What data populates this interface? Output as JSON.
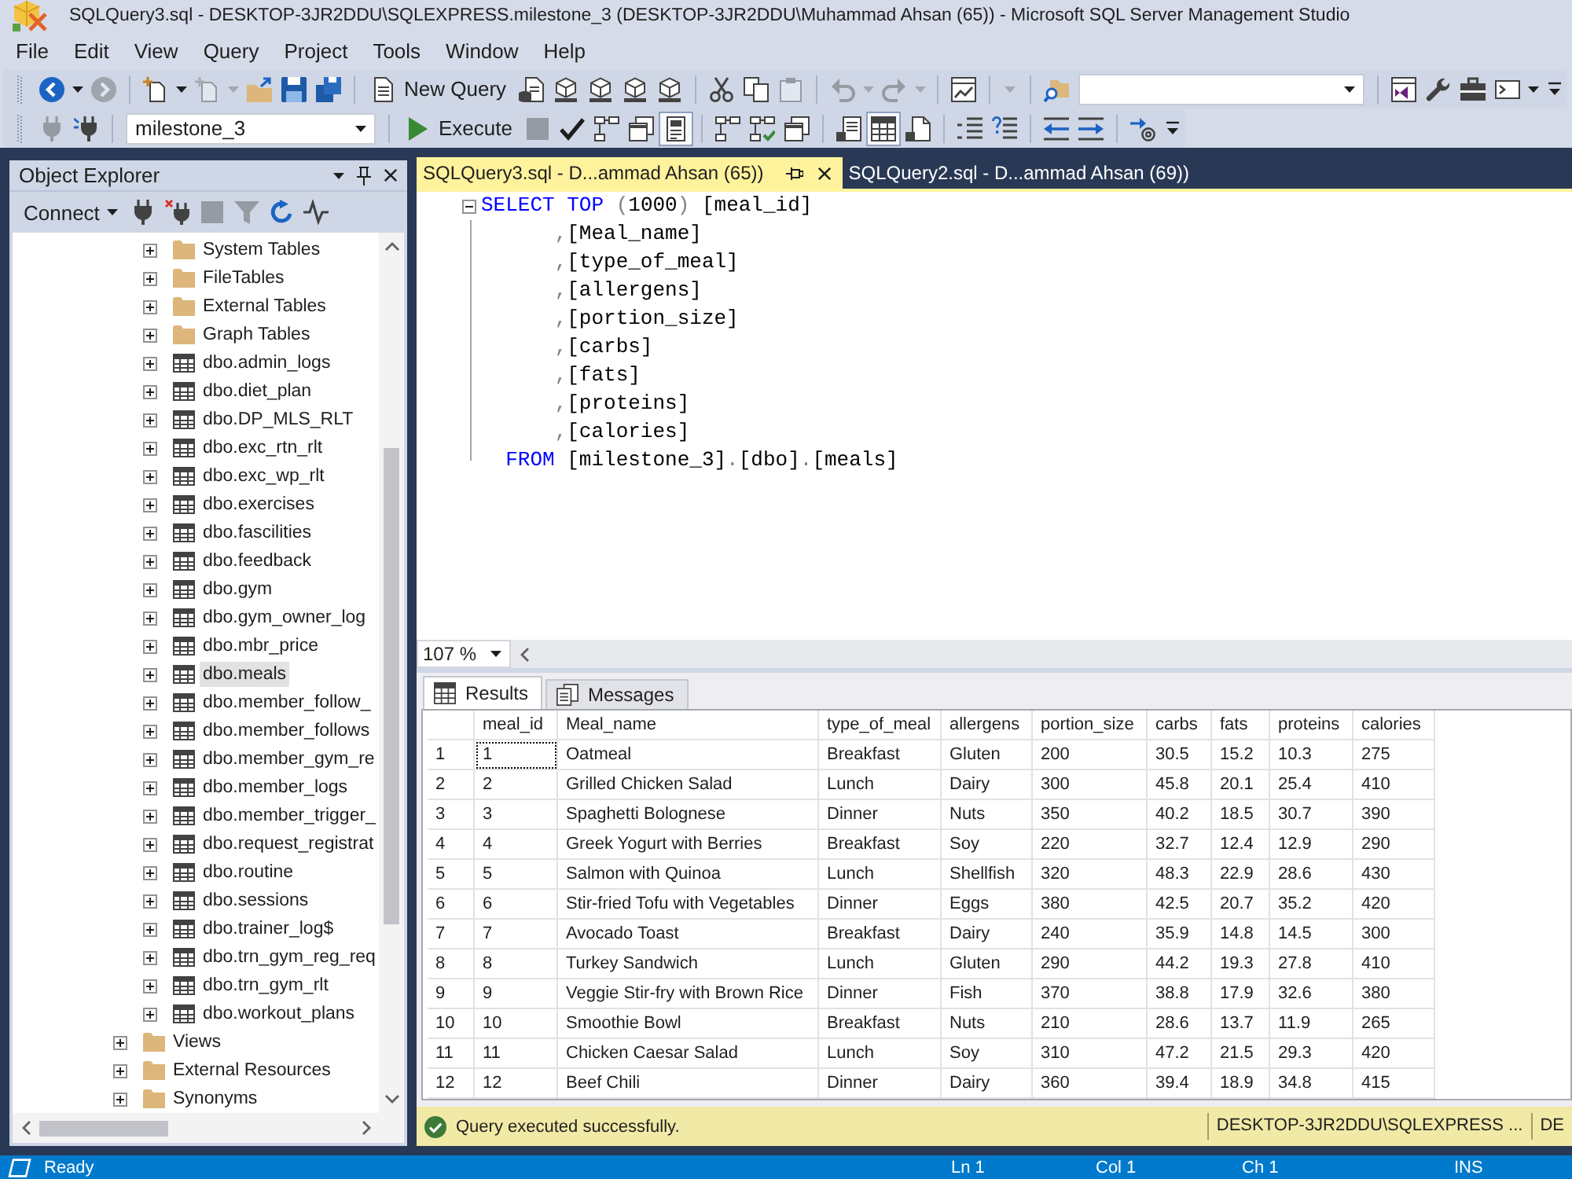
{
  "window": {
    "title": "SQLQuery3.sql - DESKTOP-3JR2DDU\\SQLEXPRESS.milestone_3 (DESKTOP-3JR2DDU\\Muhammad Ahsan (65)) - Microsoft SQL Server Management Studio"
  },
  "menu": [
    "File",
    "Edit",
    "View",
    "Query",
    "Project",
    "Tools",
    "Window",
    "Help"
  ],
  "toolbar_1": {
    "groups": [
      [
        {
          "kind": "split",
          "disabled": false
        },
        {
          "kind": "button",
          "disabled": true
        }
      ],
      [
        {
          "kind": "split",
          "disabled": false
        },
        {
          "kind": "split",
          "disabled": true
        },
        {
          "kind": "button",
          "disabled": false
        },
        {
          "kind": "button",
          "disabled": false
        },
        {
          "kind": "button",
          "disabled": false
        }
      ],
      [
        {
          "kind": "labeled",
          "label": "New Query",
          "disabled": false
        },
        {
          "kind": "button",
          "disabled": false
        },
        {
          "kind": "button",
          "disabled": false
        },
        {
          "kind": "button",
          "disabled": false
        },
        {
          "kind": "button",
          "disabled": false
        },
        {
          "kind": "button",
          "disabled": false
        }
      ],
      [
        {
          "kind": "button",
          "disabled": false
        },
        {
          "kind": "button",
          "disabled": false
        },
        {
          "kind": "button",
          "disabled": true
        }
      ],
      [
        {
          "kind": "split",
          "disabled": true
        },
        {
          "kind": "split",
          "disabled": true
        }
      ],
      [
        {
          "kind": "button",
          "disabled": false
        }
      ],
      [
        {
          "kind": "caret",
          "disabled": true
        }
      ],
      [
        {
          "kind": "button",
          "disabled": false
        },
        {
          "kind": "combo"
        }
      ],
      [
        {
          "kind": "button",
          "disabled": false
        },
        {
          "kind": "button",
          "disabled": false
        },
        {
          "kind": "button",
          "disabled": false
        },
        {
          "kind": "split",
          "disabled": false
        }
      ]
    ]
  },
  "toolbar_2": {
    "groups": [
      [
        {
          "kind": "button",
          "disabled": true
        },
        {
          "kind": "button",
          "disabled": false
        }
      ],
      [
        {
          "kind": "combo",
          "value": "milestone_3"
        }
      ],
      [
        {
          "kind": "labeled",
          "label": "Execute",
          "disabled": false
        },
        {
          "kind": "button",
          "disabled": true
        },
        {
          "kind": "button",
          "disabled": false
        },
        {
          "kind": "button",
          "disabled": false
        },
        {
          "kind": "button",
          "disabled": false
        },
        {
          "kind": "button",
          "disabled": false,
          "pressed": true
        }
      ],
      [
        {
          "kind": "button",
          "disabled": false,
          "pressed": false
        },
        {
          "kind": "button",
          "disabled": false,
          "pressed": false
        },
        {
          "kind": "button",
          "disabled": false,
          "pressed": false
        }
      ],
      [
        {
          "kind": "button",
          "disabled": false,
          "pressed": false
        },
        {
          "kind": "button",
          "disabled": false,
          "pressed": true
        },
        {
          "kind": "button",
          "disabled": false,
          "pressed": false
        }
      ],
      [
        {
          "kind": "button",
          "disabled": false
        },
        {
          "kind": "button",
          "disabled": false
        }
      ],
      [
        {
          "kind": "button",
          "disabled": false
        },
        {
          "kind": "button",
          "disabled": false
        }
      ],
      [
        {
          "kind": "button",
          "disabled": false
        }
      ]
    ]
  },
  "object_explorer": {
    "title": "Object Explorer",
    "toolbar": [
      {
        "kind": "menu",
        "label": "Connect",
        "disabled": false
      },
      {
        "kind": "button",
        "disabled": false
      },
      {
        "kind": "button",
        "disabled": false
      },
      {
        "kind": "button",
        "disabled": true
      },
      {
        "kind": "button",
        "disabled": true
      },
      {
        "kind": "button",
        "disabled": false
      },
      {
        "kind": "button",
        "disabled": false
      }
    ],
    "tree": {
      "items": [
        {
          "children": [
            {
              "kind": "folder",
              "label": "System Tables",
              "expanded": false,
              "selected": false
            },
            {
              "kind": "folder",
              "label": "FileTables",
              "expanded": false,
              "selected": false
            },
            {
              "kind": "folder",
              "label": "External Tables",
              "expanded": false,
              "selected": false
            },
            {
              "kind": "folder",
              "label": "Graph Tables",
              "expanded": false,
              "selected": false
            },
            {
              "kind": "table",
              "label": "dbo.admin_logs",
              "expanded": false,
              "selected": false
            },
            {
              "kind": "table",
              "label": "dbo.diet_plan",
              "expanded": false,
              "selected": false
            },
            {
              "kind": "table",
              "label": "dbo.DP_MLS_RLT",
              "expanded": false,
              "selected": false
            },
            {
              "kind": "table",
              "label": "dbo.exc_rtn_rlt",
              "expanded": false,
              "selected": false
            },
            {
              "kind": "table",
              "label": "dbo.exc_wp_rlt",
              "expanded": false,
              "selected": false
            },
            {
              "kind": "table",
              "label": "dbo.exercises",
              "expanded": false,
              "selected": false
            },
            {
              "kind": "table",
              "label": "dbo.fascilities",
              "expanded": false,
              "selected": false
            },
            {
              "kind": "table",
              "label": "dbo.feedback",
              "expanded": false,
              "selected": false
            },
            {
              "kind": "table",
              "label": "dbo.gym",
              "expanded": false,
              "selected": false
            },
            {
              "kind": "table",
              "label": "dbo.gym_owner_log",
              "expanded": false,
              "selected": false
            },
            {
              "kind": "table",
              "label": "dbo.mbr_price",
              "expanded": false,
              "selected": false
            },
            {
              "kind": "table",
              "label": "dbo.meals",
              "expanded": false,
              "selected": true
            },
            {
              "kind": "table",
              "label": "dbo.member_follow_",
              "expanded": false,
              "selected": false
            },
            {
              "kind": "table",
              "label": "dbo.member_follows",
              "expanded": false,
              "selected": false
            },
            {
              "kind": "table",
              "label": "dbo.member_gym_re",
              "expanded": false,
              "selected": false
            },
            {
              "kind": "table",
              "label": "dbo.member_logs",
              "expanded": false,
              "selected": false
            },
            {
              "kind": "table",
              "label": "dbo.member_trigger_",
              "expanded": false,
              "selected": false
            },
            {
              "kind": "table",
              "label": "dbo.request_registrat",
              "expanded": false,
              "selected": false
            },
            {
              "kind": "table",
              "label": "dbo.routine",
              "expanded": false,
              "selected": false
            },
            {
              "kind": "table",
              "label": "dbo.sessions",
              "expanded": false,
              "selected": false
            },
            {
              "kind": "table",
              "label": "dbo.trainer_log$",
              "expanded": false,
              "selected": false
            },
            {
              "kind": "table",
              "label": "dbo.trn_gym_reg_req",
              "expanded": false,
              "selected": false
            },
            {
              "kind": "table",
              "label": "dbo.trn_gym_rlt",
              "expanded": false,
              "selected": false
            },
            {
              "kind": "table",
              "label": "dbo.workout_plans",
              "expanded": false,
              "selected": false
            }
          ]
        },
        {
          "kind": "folder",
          "label": "Views",
          "expanded": false,
          "selected": false
        },
        {
          "kind": "folder",
          "label": "External Resources",
          "expanded": false,
          "selected": false
        },
        {
          "kind": "folder",
          "label": "Synonyms",
          "expanded": false,
          "selected": false
        }
      ]
    }
  },
  "editor": {
    "tabs": [
      {
        "label": "SQLQuery3.sql - D...ammad Ahsan (65))",
        "selected": true
      },
      {
        "label": "SQLQuery2.sql - D...ammad Ahsan (69))",
        "selected": false
      }
    ],
    "region_expanded": true,
    "code": [
      {
        "tokens": [
          {
            "kind": "keyword",
            "text": "SELECT TOP "
          },
          {
            "kind": "operator",
            "text": "("
          },
          {
            "kind": "plain",
            "text": "1000"
          },
          {
            "kind": "operator",
            "text": ")"
          },
          {
            "kind": "plain",
            "text": " [meal_id]"
          }
        ]
      },
      {
        "tokens": [
          {
            "kind": "operator",
            "text": "      ,"
          },
          {
            "kind": "plain",
            "text": "[Meal_name]"
          }
        ]
      },
      {
        "tokens": [
          {
            "kind": "operator",
            "text": "      ,"
          },
          {
            "kind": "plain",
            "text": "[type_of_meal]"
          }
        ]
      },
      {
        "tokens": [
          {
            "kind": "operator",
            "text": "      ,"
          },
          {
            "kind": "plain",
            "text": "[allergens]"
          }
        ]
      },
      {
        "tokens": [
          {
            "kind": "operator",
            "text": "      ,"
          },
          {
            "kind": "plain",
            "text": "[portion_size]"
          }
        ]
      },
      {
        "tokens": [
          {
            "kind": "operator",
            "text": "      ,"
          },
          {
            "kind": "plain",
            "text": "[carbs]"
          }
        ]
      },
      {
        "tokens": [
          {
            "kind": "operator",
            "text": "      ,"
          },
          {
            "kind": "plain",
            "text": "[fats]"
          }
        ]
      },
      {
        "tokens": [
          {
            "kind": "operator",
            "text": "      ,"
          },
          {
            "kind": "plain",
            "text": "[proteins]"
          }
        ]
      },
      {
        "tokens": [
          {
            "kind": "operator",
            "text": "      ,"
          },
          {
            "kind": "plain",
            "text": "[calories]"
          }
        ]
      },
      {
        "tokens": [
          {
            "kind": "keyword",
            "text": "  FROM "
          },
          {
            "kind": "plain",
            "text": "[milestone_3]"
          },
          {
            "kind": "operator",
            "text": "."
          },
          {
            "kind": "plain",
            "text": "[dbo]"
          },
          {
            "kind": "operator",
            "text": "."
          },
          {
            "kind": "plain",
            "text": "[meals]"
          }
        ]
      }
    ],
    "zoom": "107 %"
  },
  "results": {
    "tabs": [
      {
        "label": "Results",
        "selected": true
      },
      {
        "label": "Messages",
        "selected": false
      }
    ],
    "grid": {
      "columns": [
        "meal_id",
        "Meal_name",
        "type_of_meal",
        "allergens",
        "portion_size",
        "carbs",
        "fats",
        "proteins",
        "calories"
      ],
      "rows": [
        {
          "number": "1",
          "cells": [
            {
              "text": "1",
              "focused": true
            },
            {
              "text": "Oatmeal",
              "focused": false
            },
            {
              "text": "Breakfast",
              "focused": false
            },
            {
              "text": "Gluten",
              "focused": false
            },
            {
              "text": "200",
              "focused": false
            },
            {
              "text": "30.5",
              "focused": false
            },
            {
              "text": "15.2",
              "focused": false
            },
            {
              "text": "10.3",
              "focused": false
            },
            {
              "text": "275",
              "focused": false
            }
          ]
        },
        {
          "number": "2",
          "cells": [
            {
              "text": "2",
              "focused": false
            },
            {
              "text": "Grilled Chicken Salad",
              "focused": false
            },
            {
              "text": "Lunch",
              "focused": false
            },
            {
              "text": "Dairy",
              "focused": false
            },
            {
              "text": "300",
              "focused": false
            },
            {
              "text": "45.8",
              "focused": false
            },
            {
              "text": "20.1",
              "focused": false
            },
            {
              "text": "25.4",
              "focused": false
            },
            {
              "text": "410",
              "focused": false
            }
          ]
        },
        {
          "number": "3",
          "cells": [
            {
              "text": "3",
              "focused": false
            },
            {
              "text": "Spaghetti Bolognese",
              "focused": false
            },
            {
              "text": "Dinner",
              "focused": false
            },
            {
              "text": "Nuts",
              "focused": false
            },
            {
              "text": "350",
              "focused": false
            },
            {
              "text": "40.2",
              "focused": false
            },
            {
              "text": "18.5",
              "focused": false
            },
            {
              "text": "30.7",
              "focused": false
            },
            {
              "text": "390",
              "focused": false
            }
          ]
        },
        {
          "number": "4",
          "cells": [
            {
              "text": "4",
              "focused": false
            },
            {
              "text": "Greek Yogurt with Berries",
              "focused": false
            },
            {
              "text": "Breakfast",
              "focused": false
            },
            {
              "text": "Soy",
              "focused": false
            },
            {
              "text": "220",
              "focused": false
            },
            {
              "text": "32.7",
              "focused": false
            },
            {
              "text": "12.4",
              "focused": false
            },
            {
              "text": "12.9",
              "focused": false
            },
            {
              "text": "290",
              "focused": false
            }
          ]
        },
        {
          "number": "5",
          "cells": [
            {
              "text": "5",
              "focused": false
            },
            {
              "text": "Salmon with Quinoa",
              "focused": false
            },
            {
              "text": "Lunch",
              "focused": false
            },
            {
              "text": "Shellfish",
              "focused": false
            },
            {
              "text": "320",
              "focused": false
            },
            {
              "text": "48.3",
              "focused": false
            },
            {
              "text": "22.9",
              "focused": false
            },
            {
              "text": "28.6",
              "focused": false
            },
            {
              "text": "430",
              "focused": false
            }
          ]
        },
        {
          "number": "6",
          "cells": [
            {
              "text": "6",
              "focused": false
            },
            {
              "text": "Stir-fried Tofu with Vegetables",
              "focused": false
            },
            {
              "text": "Dinner",
              "focused": false
            },
            {
              "text": "Eggs",
              "focused": false
            },
            {
              "text": "380",
              "focused": false
            },
            {
              "text": "42.5",
              "focused": false
            },
            {
              "text": "20.7",
              "focused": false
            },
            {
              "text": "35.2",
              "focused": false
            },
            {
              "text": "420",
              "focused": false
            }
          ]
        },
        {
          "number": "7",
          "cells": [
            {
              "text": "7",
              "focused": false
            },
            {
              "text": "Avocado Toast",
              "focused": false
            },
            {
              "text": "Breakfast",
              "focused": false
            },
            {
              "text": "Dairy",
              "focused": false
            },
            {
              "text": "240",
              "focused": false
            },
            {
              "text": "35.9",
              "focused": false
            },
            {
              "text": "14.8",
              "focused": false
            },
            {
              "text": "14.5",
              "focused": false
            },
            {
              "text": "300",
              "focused": false
            }
          ]
        },
        {
          "number": "8",
          "cells": [
            {
              "text": "8",
              "focused": false
            },
            {
              "text": "Turkey Sandwich",
              "focused": false
            },
            {
              "text": "Lunch",
              "focused": false
            },
            {
              "text": "Gluten",
              "focused": false
            },
            {
              "text": "290",
              "focused": false
            },
            {
              "text": "44.2",
              "focused": false
            },
            {
              "text": "19.3",
              "focused": false
            },
            {
              "text": "27.8",
              "focused": false
            },
            {
              "text": "410",
              "focused": false
            }
          ]
        },
        {
          "number": "9",
          "cells": [
            {
              "text": "9",
              "focused": false
            },
            {
              "text": "Veggie Stir-fry with Brown Rice",
              "focused": false
            },
            {
              "text": "Dinner",
              "focused": false
            },
            {
              "text": "Fish",
              "focused": false
            },
            {
              "text": "370",
              "focused": false
            },
            {
              "text": "38.8",
              "focused": false
            },
            {
              "text": "17.9",
              "focused": false
            },
            {
              "text": "32.6",
              "focused": false
            },
            {
              "text": "380",
              "focused": false
            }
          ]
        },
        {
          "number": "10",
          "cells": [
            {
              "text": "10",
              "focused": false
            },
            {
              "text": "Smoothie Bowl",
              "focused": false
            },
            {
              "text": "Breakfast",
              "focused": false
            },
            {
              "text": "Nuts",
              "focused": false
            },
            {
              "text": "210",
              "focused": false
            },
            {
              "text": "28.6",
              "focused": false
            },
            {
              "text": "13.7",
              "focused": false
            },
            {
              "text": "11.9",
              "focused": false
            },
            {
              "text": "265",
              "focused": false
            }
          ]
        },
        {
          "number": "11",
          "cells": [
            {
              "text": "11",
              "focused": false
            },
            {
              "text": "Chicken Caesar Salad",
              "focused": false
            },
            {
              "text": "Lunch",
              "focused": false
            },
            {
              "text": "Soy",
              "focused": false
            },
            {
              "text": "310",
              "focused": false
            },
            {
              "text": "47.2",
              "focused": false
            },
            {
              "text": "21.5",
              "focused": false
            },
            {
              "text": "29.3",
              "focused": false
            },
            {
              "text": "420",
              "focused": false
            }
          ]
        },
        {
          "number": "12",
          "cells": [
            {
              "text": "12",
              "focused": false
            },
            {
              "text": "Beef Chili",
              "focused": false
            },
            {
              "text": "Dinner",
              "focused": false
            },
            {
              "text": "Dairy",
              "focused": false
            },
            {
              "text": "360",
              "focused": false
            },
            {
              "text": "39.4",
              "focused": false
            },
            {
              "text": "18.9",
              "focused": false
            },
            {
              "text": "34.8",
              "focused": false
            },
            {
              "text": "415",
              "focused": false
            }
          ]
        }
      ]
    },
    "status": {
      "message": "Query executed successfully.",
      "server": "DESKTOP-3JR2DDU\\SQLEXPRESS ...",
      "field_3": "DE"
    }
  },
  "status_bar": {
    "text": "Ready",
    "line": "Ln 1",
    "column": "Col 1",
    "char": "Ch 1",
    "mode": "INS"
  }
}
